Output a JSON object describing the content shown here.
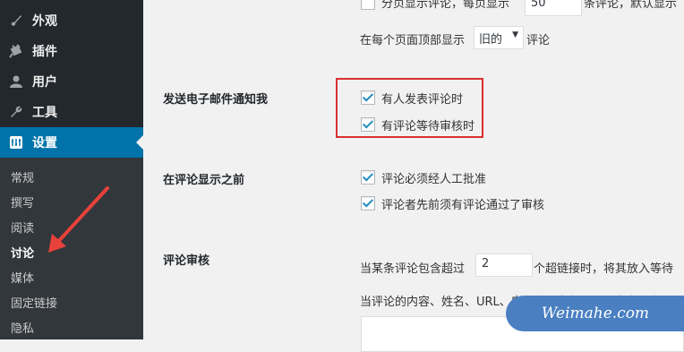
{
  "sidebar": {
    "items": [
      {
        "label": "外观",
        "icon": "paintbrush-icon"
      },
      {
        "label": "插件",
        "icon": "plugin-icon"
      },
      {
        "label": "用户",
        "icon": "user-icon"
      },
      {
        "label": "工具",
        "icon": "wrench-icon"
      },
      {
        "label": "设置",
        "icon": "settings-icon"
      }
    ],
    "submenu": [
      "常规",
      "撰写",
      "阅读",
      "讨论",
      "媒体",
      "固定链接",
      "隐私"
    ],
    "current": "讨论"
  },
  "settings": {
    "pagination_row": {
      "text_before": "分页显示评论，每页显示",
      "per_page_value": "50",
      "text_after": "条评论，默认显示"
    },
    "order_row": {
      "text_before": "在每个页面顶部显示",
      "select_value": "旧的",
      "text_after": "评论"
    },
    "email_notify": {
      "label": "发送电子邮件通知我",
      "options": [
        {
          "label": "有人发表评论时",
          "checked": true
        },
        {
          "label": "有评论等待审核时",
          "checked": true
        }
      ]
    },
    "before_comment_appears": {
      "label": "在评论显示之前",
      "options": [
        {
          "label": "评论必须经人工批准",
          "checked": true
        },
        {
          "label": "评论者先前须有评论通过了审核",
          "checked": true
        }
      ]
    },
    "moderation": {
      "label": "评论审核",
      "text_before": "当某条评论包含超过",
      "links_value": "2",
      "text_after": "个超链接时，将其放入等待",
      "description": "当评论的内容、姓名、URL、电邮或IP中包含以下文字，它"
    }
  },
  "watermark": "Weimahe.com",
  "colors": {
    "sidebar_bg": "#23282d",
    "submenu_bg": "#32373c",
    "active": "#0073aa",
    "highlight": "#d9302f"
  }
}
